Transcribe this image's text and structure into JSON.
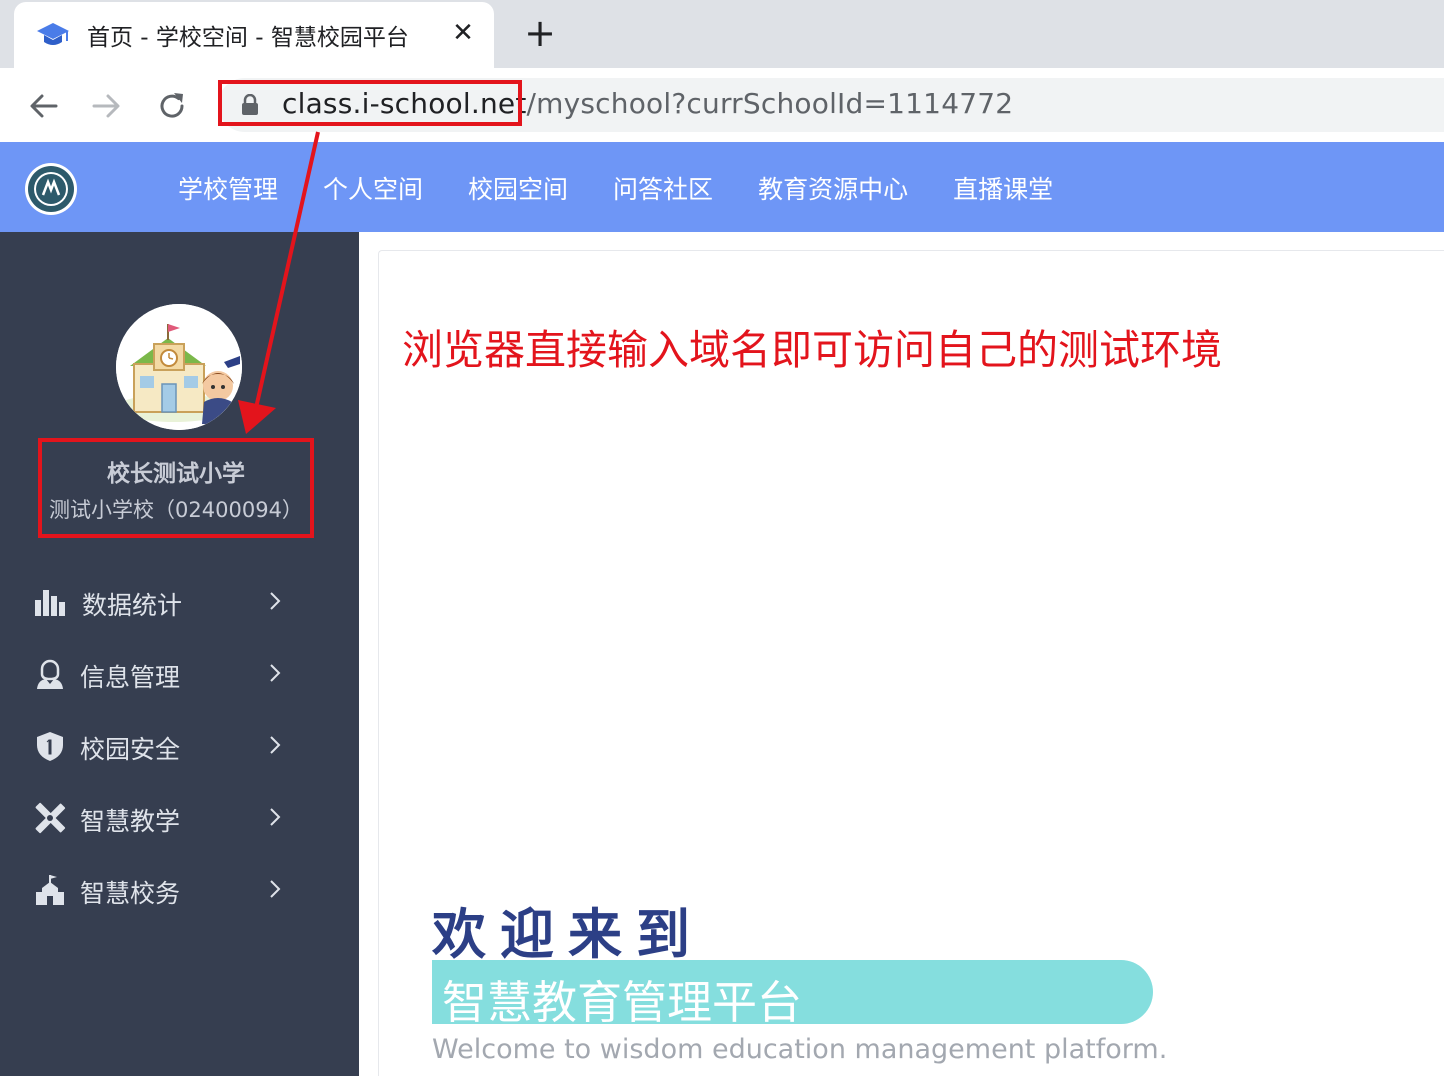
{
  "browser": {
    "tab_title": "首页 - 学校空间 - 智慧校园平台",
    "tab_close_glyph": "✕",
    "new_tab_glyph": "+",
    "url_host": "class.i-school.net",
    "url_path": "/myschool?currSchoolId=1114772"
  },
  "nav": {
    "items": [
      {
        "label": "学校管理"
      },
      {
        "label": "个人空间"
      },
      {
        "label": "校园空间"
      },
      {
        "label": "问答社区"
      },
      {
        "label": "教育资源中心"
      },
      {
        "label": "直播课堂"
      }
    ]
  },
  "sidebar": {
    "user_name": "校长测试小学",
    "school": "测试小学校（02400094）",
    "menu": [
      {
        "label": "数据统计",
        "icon": "bar-chart-icon"
      },
      {
        "label": "信息管理",
        "icon": "user-icon"
      },
      {
        "label": "校园安全",
        "icon": "shield-icon"
      },
      {
        "label": "智慧教学",
        "icon": "tools-icon"
      },
      {
        "label": "智慧校务",
        "icon": "building-icon"
      }
    ]
  },
  "main": {
    "annotation": "浏览器直接输入域名即可访问自己的测试环境",
    "welcome": "欢迎来到",
    "platform_name": "智慧教育管理平台",
    "welcome_en": "Welcome to wisdom education management platform."
  },
  "colors": {
    "header_bg": "#6e96f6",
    "sidebar_bg": "#363e50",
    "annotation_red": "#e3141c",
    "banner_teal": "#85dede",
    "welcome_navy": "#2c3f86"
  }
}
